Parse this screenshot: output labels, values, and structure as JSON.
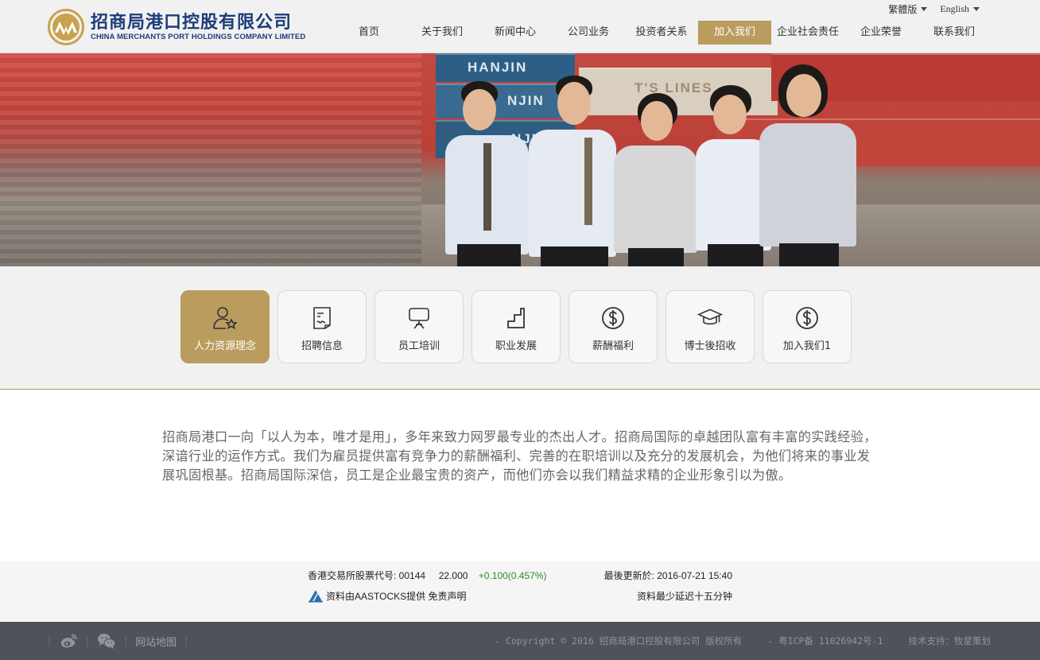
{
  "header": {
    "logo": {
      "cn": "招商局港口控股有限公司",
      "en": "CHINA MERCHANTS PORT HOLDINGS COMPANY LIMITED",
      "brand_gold": "#c8a24e",
      "brand_blue": "#1d3c7a"
    },
    "lang": [
      {
        "label": "繁體版"
      },
      {
        "label": "English"
      }
    ],
    "nav": [
      {
        "label": "首页"
      },
      {
        "label": "关于我们"
      },
      {
        "label": "新闻中心"
      },
      {
        "label": "公司业务"
      },
      {
        "label": "投资者关系"
      },
      {
        "label": "加入我们",
        "active": true
      },
      {
        "label": "企业社会责任"
      },
      {
        "label": "企业荣誉"
      },
      {
        "label": "联系我们"
      }
    ],
    "accent_color": "#b99c5e"
  },
  "banner": {
    "container_labels": [
      "HANJIN",
      "NJIN",
      "T'S LINES",
      "NJIN"
    ]
  },
  "tabs": [
    {
      "label": "人力资源理念",
      "icon": "user-star-icon",
      "active": true
    },
    {
      "label": "招聘信息",
      "icon": "document-icon"
    },
    {
      "label": "员工培训",
      "icon": "presentation-board-icon"
    },
    {
      "label": "职业发展",
      "icon": "steps-icon"
    },
    {
      "label": "薪酬福利",
      "icon": "dollar-coin-icon"
    },
    {
      "label": "博士後招收",
      "icon": "graduation-cap-icon"
    },
    {
      "label": "加入我们1",
      "icon": "dollar-coin-icon"
    }
  ],
  "content": {
    "text": "招商局港口一向「以人为本，唯才是用」，多年来致力网罗最专业的杰出人才。招商局国际的卓越团队富有丰富的实践经验，深谙行业的运作方式。我们为雇员提供富有竞争力的薪酬福利、完善的在职培训以及充分的发展机会，为他们将来的事业发展巩固根基。招商局国际深信，员工是企业最宝贵的资产，而他们亦会以我们精益求精的企业形象引以为傲。"
  },
  "stock": {
    "code_label": "香港交易所股票代号: 00144",
    "price": "22.000",
    "change": "+0.100(0.457%)",
    "updated": "最後更新於: 2016-07-21 15:40",
    "source": "资料由AASTOCKS提供 免责声明",
    "delay": "资料最少延迟十五分钟",
    "change_color": "#2a8a2a"
  },
  "footer": {
    "sitemap": "网站地图",
    "copyright": "- Copyright © 2016 招商局港口控股有限公司 版权所有",
    "icp": "- 粤ICP备 11026942号-1",
    "support": "技术支持：牧星策划",
    "social": [
      "weibo-icon",
      "wechat-icon"
    ]
  }
}
